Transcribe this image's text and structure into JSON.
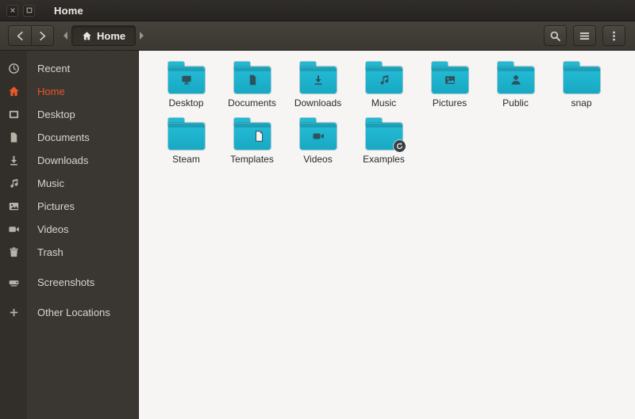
{
  "window": {
    "title": "Home"
  },
  "toolbar": {
    "path_label": "Home",
    "icons": {
      "back": "arrow-left",
      "forward": "arrow-right",
      "search": "magnifier",
      "view": "list-lines",
      "menu": "vertical-dots"
    }
  },
  "sidebar": {
    "items": [
      {
        "label": "Recent",
        "icon": "clock-icon",
        "active": false
      },
      {
        "label": "Home",
        "icon": "home-icon",
        "active": true
      },
      {
        "label": "Desktop",
        "icon": "frame-icon",
        "active": false
      },
      {
        "label": "Documents",
        "icon": "document-icon",
        "active": false
      },
      {
        "label": "Downloads",
        "icon": "download-icon",
        "active": false
      },
      {
        "label": "Music",
        "icon": "music-icon",
        "active": false
      },
      {
        "label": "Pictures",
        "icon": "picture-icon",
        "active": false
      },
      {
        "label": "Videos",
        "icon": "video-icon",
        "active": false
      },
      {
        "label": "Trash",
        "icon": "trash-icon",
        "active": false
      },
      {
        "label": "Screenshots",
        "icon": "drive-icon",
        "active": false
      },
      {
        "label": "Other Locations",
        "icon": "plus-icon",
        "active": false
      }
    ]
  },
  "files": {
    "items": [
      {
        "name": "Desktop",
        "emblem": "monitor"
      },
      {
        "name": "Documents",
        "emblem": "document"
      },
      {
        "name": "Downloads",
        "emblem": "arrow-down"
      },
      {
        "name": "Music",
        "emblem": "music-note"
      },
      {
        "name": "Pictures",
        "emblem": "photo"
      },
      {
        "name": "Public",
        "emblem": "person"
      },
      {
        "name": "snap",
        "emblem": "none"
      },
      {
        "name": "Steam",
        "emblem": "none"
      },
      {
        "name": "Templates",
        "emblem": "template-page"
      },
      {
        "name": "Videos",
        "emblem": "video-camera"
      },
      {
        "name": "Examples",
        "emblem": "link-badge"
      }
    ]
  },
  "colors": {
    "accent_orange": "#E8572A",
    "folder_teal": "#1FB6D0",
    "emblem_dark": "#2E525E",
    "titlebar": "#2B2824",
    "sidebar": "#3A3733",
    "main_bg": "#F6F5F3"
  }
}
